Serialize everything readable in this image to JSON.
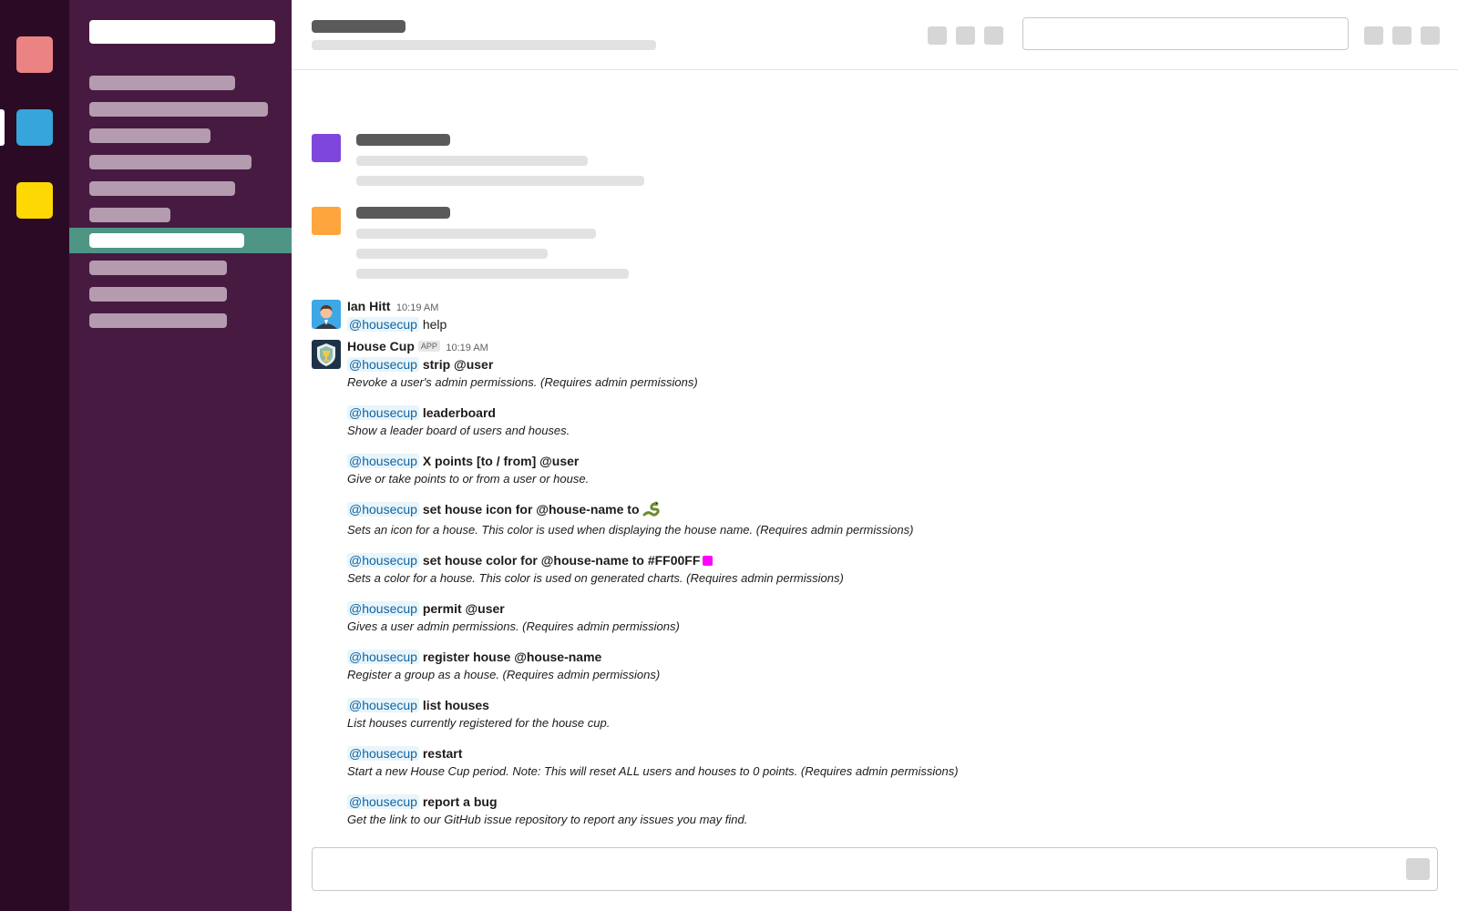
{
  "colors": {
    "rail": "#2a0a24",
    "sidebar": "#471a41",
    "active_channel": "#4e9586",
    "mention_text": "#1264a3",
    "workspace_1": "#ec8383",
    "workspace_2": "#36a5db",
    "workspace_3": "#fdd803",
    "skeleton_avatar_1": "#7e46dc",
    "skeleton_avatar_2": "#fea63d",
    "house_color_swatch": "#FF00FF"
  },
  "messages": [
    {
      "author": "Ian Hitt",
      "time": "10:19 AM",
      "avatar_icon": "user-avatar-icon",
      "mention": "@housecup",
      "text": "help"
    },
    {
      "author": "House Cup",
      "badge": "APP",
      "time": "10:19 AM",
      "avatar_icon": "house-cup-shield-icon",
      "entries": [
        {
          "mention": "@housecup",
          "command": "strip @user",
          "description": "Revoke a user's admin permissions. (Requires admin permissions)"
        },
        {
          "mention": "@housecup",
          "command": "leaderboard",
          "description": "Show a leader board of users and houses."
        },
        {
          "mention": "@housecup",
          "command": "X points [to / from] @user",
          "description": "Give or take points to or from a user or house."
        },
        {
          "mention": "@housecup",
          "command": "set house icon for @house-name to",
          "command_icon": "snake-emoji-icon",
          "description": "Sets an icon for a house. This color is used when displaying the house name. (Requires admin permissions)"
        },
        {
          "mention": "@housecup",
          "command": "set house color for @house-name to #FF00FF",
          "description": "Sets a color for a house. This color is used on generated charts. (Requires admin permissions)"
        },
        {
          "mention": "@housecup",
          "command": "permit @user",
          "description": "Gives a user admin permissions. (Requires admin permissions)"
        },
        {
          "mention": "@housecup",
          "command": "register house @house-name",
          "description": "Register a group as a house. (Requires admin permissions)"
        },
        {
          "mention": "@housecup",
          "command": "list houses",
          "description": "List houses currently registered for the house cup."
        },
        {
          "mention": "@housecup",
          "command": "restart",
          "description": "Start a new House Cup period. Note: This will reset ALL users and houses to 0 points. (Requires admin permissions)"
        },
        {
          "mention": "@housecup",
          "command": "report a bug",
          "description": "Get the link to our GitHub issue repository to report any issues you may find."
        }
      ]
    }
  ]
}
